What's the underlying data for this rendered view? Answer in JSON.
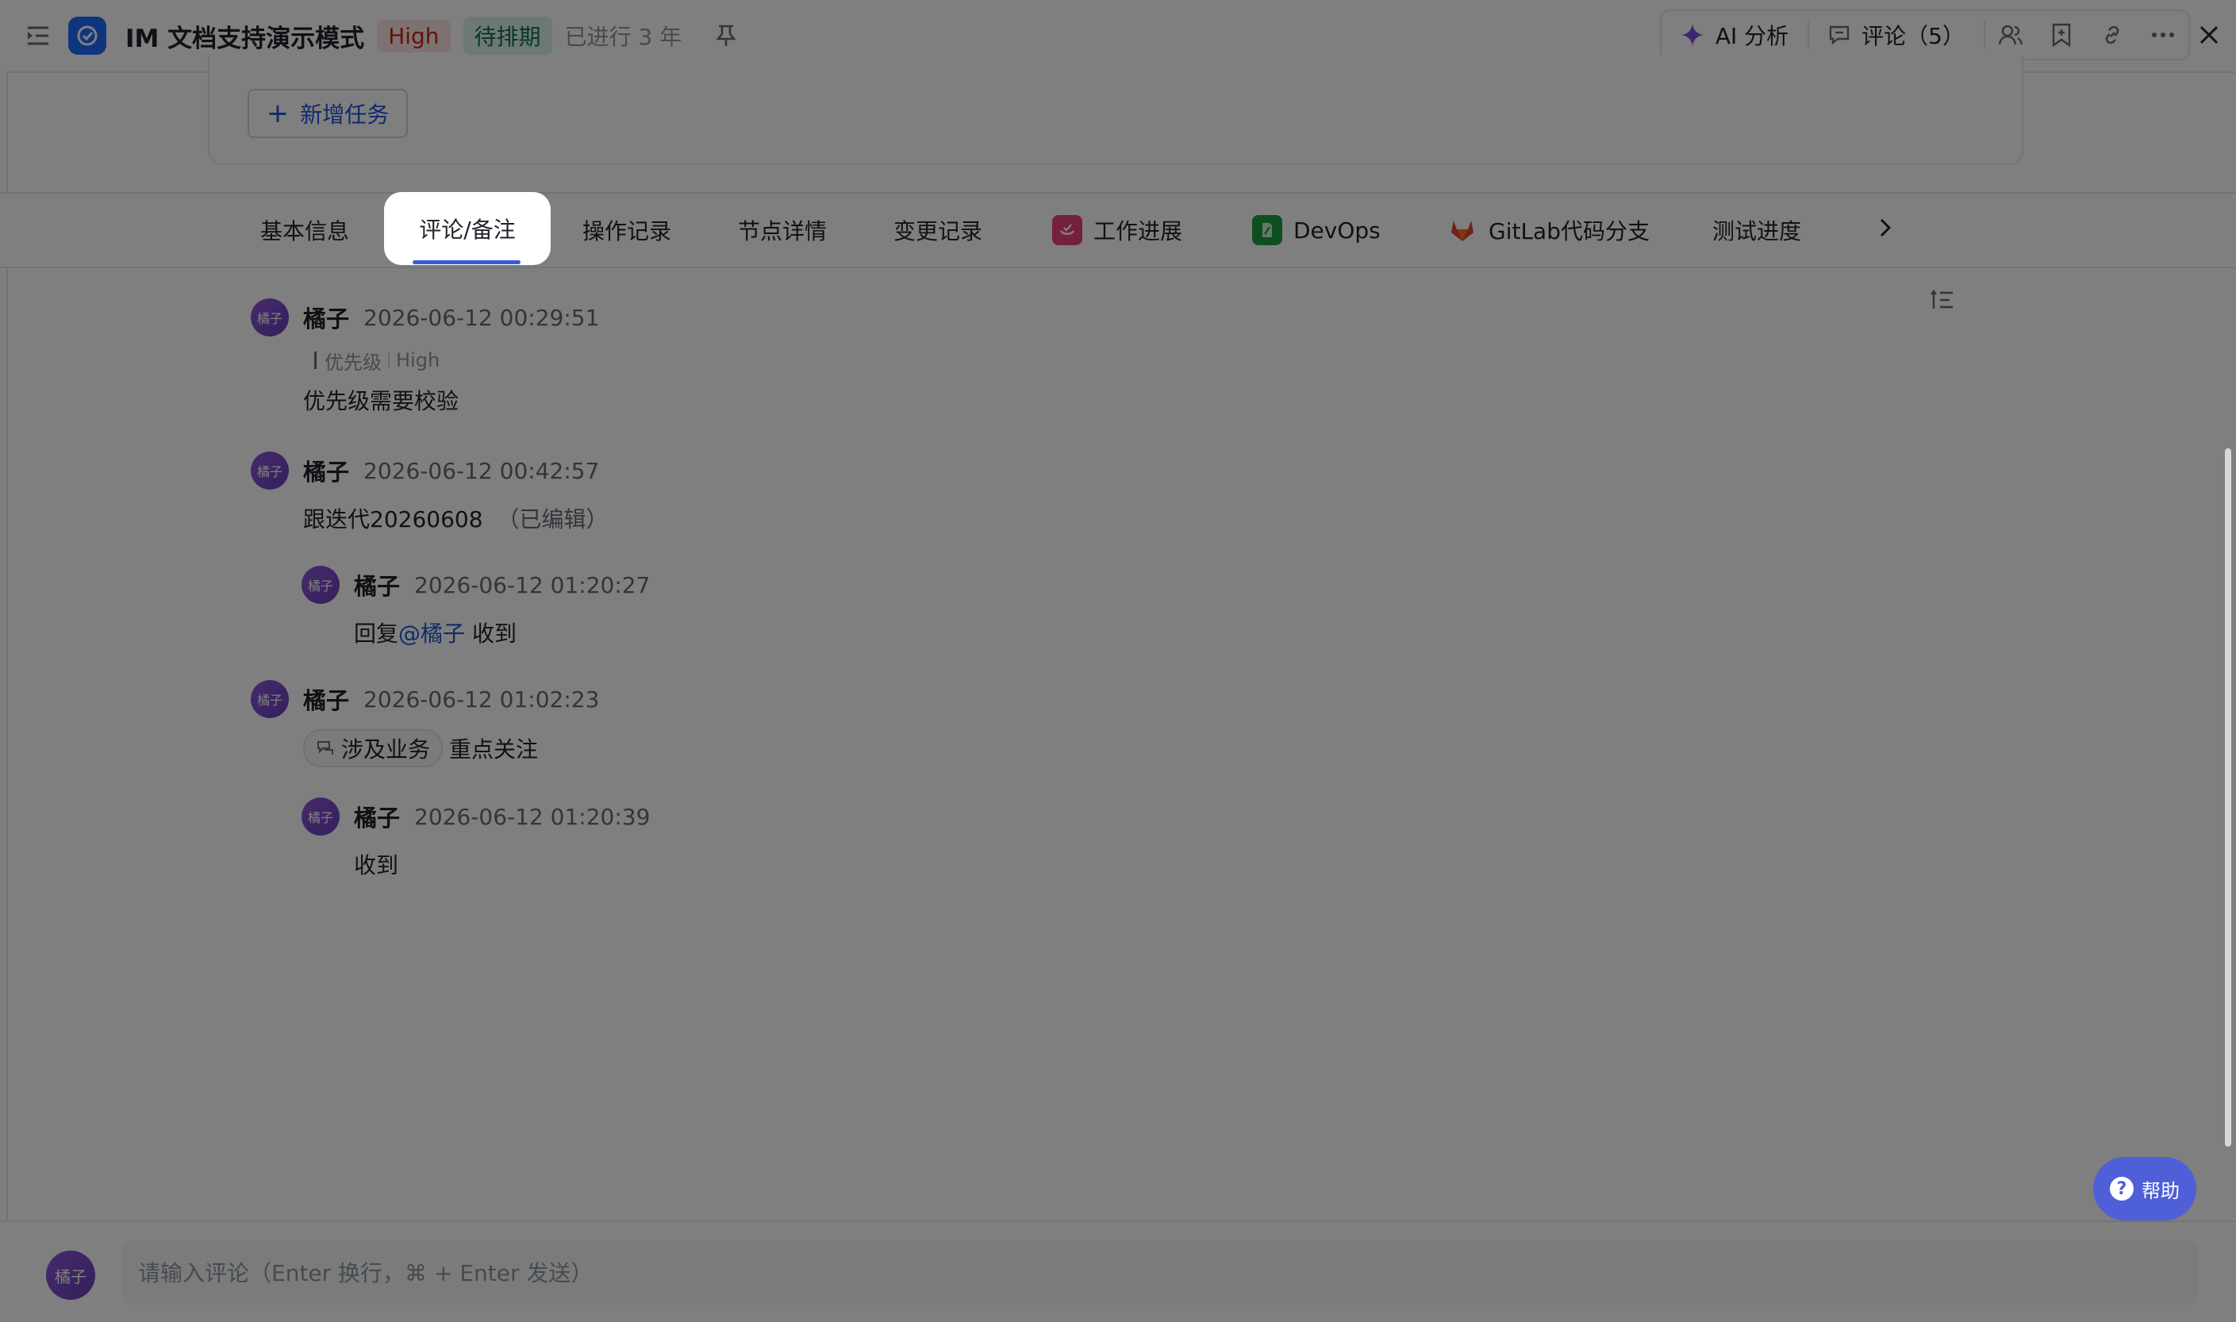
{
  "header": {
    "title": "IM 文档支持演示模式",
    "priority_tag": "High",
    "status_tag": "待排期",
    "elapsed": "已进行 3 年",
    "ai_button": "AI 分析",
    "comment_button": "评论（5）"
  },
  "card": {
    "new_task_button": "新增任务"
  },
  "tabs": [
    {
      "label": "基本信息"
    },
    {
      "label": "评论/备注",
      "active": true
    },
    {
      "label": "操作记录"
    },
    {
      "label": "节点详情"
    },
    {
      "label": "变更记录"
    },
    {
      "label": "工作进展",
      "icon": "work-progress-icon"
    },
    {
      "label": "DevOps",
      "icon": "devops-icon"
    },
    {
      "label": "GitLab代码分支",
      "icon": "gitlab-icon"
    },
    {
      "label": "测试进度"
    }
  ],
  "comments": [
    {
      "avatar": "橘子",
      "author": "橘子",
      "time": "2026-06-12 00:29:51",
      "field_change": {
        "field": "优先级",
        "value": "High"
      },
      "body": "优先级需要校验"
    },
    {
      "avatar": "橘子",
      "author": "橘子",
      "time": "2026-06-12 00:42:57",
      "body": "跟迭代20260608",
      "edited": "（已编辑）",
      "reply": {
        "avatar": "橘子",
        "author": "橘子",
        "time": "2026-06-12 01:20:27",
        "prefix": "回复",
        "mention": "@橘子",
        "body": "收到"
      }
    },
    {
      "avatar": "橘子",
      "author": "橘子",
      "time": "2026-06-12 01:02:23",
      "chip": "涉及业务",
      "body": "重点关注",
      "reply": {
        "avatar": "橘子",
        "author": "橘子",
        "time": "2026-06-12 01:20:39",
        "body": "收到"
      }
    }
  ],
  "help": {
    "label": "帮助"
  },
  "composer": {
    "avatar": "橘子",
    "placeholder": "请输入评论（Enter 换行，⌘ + Enter 发送）"
  },
  "colors": {
    "accent": "#3b5bdb",
    "app_icon": "#1f6bff",
    "priority_bg": "#fbe5e3",
    "status_bg": "#d9f3ea",
    "avatar": "#7b4bc8"
  }
}
